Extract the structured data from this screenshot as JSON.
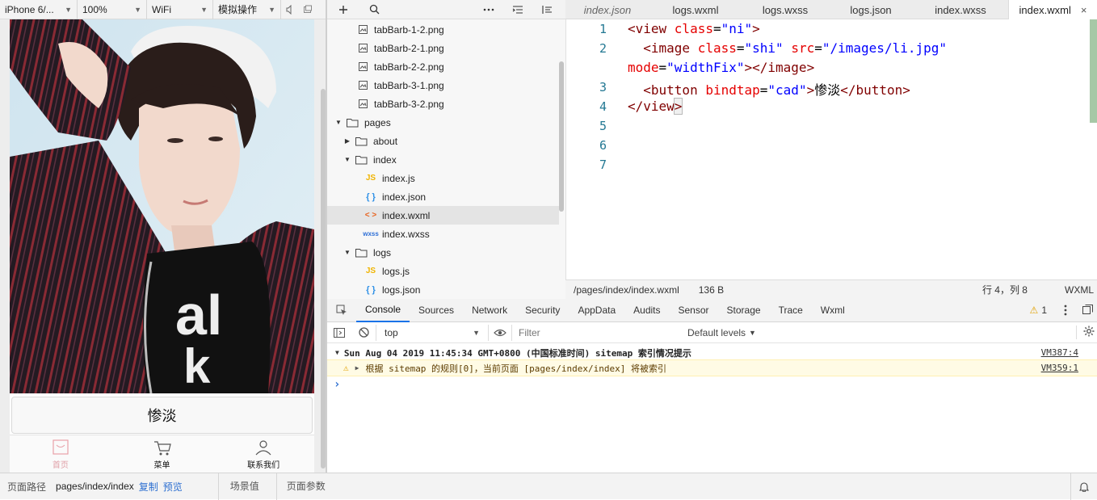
{
  "simulator": {
    "device": "iPhone 6/...",
    "zoom": "100%",
    "network": "WiFi",
    "operation": "模拟操作",
    "button_label": "惨淡",
    "tabs": [
      {
        "label": "首页",
        "active": true
      },
      {
        "label": "菜单",
        "active": false
      },
      {
        "label": "联系我们",
        "active": false
      }
    ]
  },
  "explorer": {
    "items": [
      {
        "label": "tabBarb-1-2.png",
        "type": "image"
      },
      {
        "label": "tabBarb-2-1.png",
        "type": "image"
      },
      {
        "label": "tabBarb-2-2.png",
        "type": "image"
      },
      {
        "label": "tabBarb-3-1.png",
        "type": "image"
      },
      {
        "label": "tabBarb-3-2.png",
        "type": "image"
      },
      {
        "label": "pages",
        "type": "folder-open"
      },
      {
        "label": "about",
        "type": "folder-closed"
      },
      {
        "label": "index",
        "type": "folder-open"
      },
      {
        "label": "index.js",
        "type": "js"
      },
      {
        "label": "index.json",
        "type": "json"
      },
      {
        "label": "index.wxml",
        "type": "wxml",
        "selected": true
      },
      {
        "label": "index.wxss",
        "type": "wxss"
      },
      {
        "label": "logs",
        "type": "folder-open"
      },
      {
        "label": "logs.js",
        "type": "js"
      },
      {
        "label": "logs.json",
        "type": "json"
      }
    ]
  },
  "editor": {
    "tabs": [
      {
        "label": "index.json",
        "italic": true
      },
      {
        "label": "logs.wxml"
      },
      {
        "label": "logs.wxss"
      },
      {
        "label": "logs.json"
      },
      {
        "label": "index.wxss"
      },
      {
        "label": "index.wxml",
        "active": true
      }
    ],
    "close_glyph": "×",
    "line_numbers": [
      "1",
      "2",
      "3",
      "4",
      "5",
      "6",
      "7"
    ],
    "code": {
      "l1_open": "<view ",
      "l1_attr": "class",
      "l1_eq": "=",
      "l1_val": "\"ni\"",
      "l1_close": ">",
      "l2_open": "  <image ",
      "l2_attr1": "class",
      "l2_val1": "\"shi\"",
      "l2_attr2": "src",
      "l2_val2": "\"/images/li.jpg\"",
      "l2b_attr": "mode",
      "l2b_val": "\"widthFix\"",
      "l2b_close": "></image>",
      "l3_open": "  <button ",
      "l3_attr": "bindtap",
      "l3_val": "\"cad\"",
      "l3_gt": ">",
      "l3_text": "惨淡",
      "l3_close": "</button>",
      "l4_open": "</view",
      "l4_close": ">"
    },
    "status": {
      "path": "/pages/index/index.wxml",
      "size": "136 B",
      "cursor": "行 4，列 8",
      "lang": "WXML"
    }
  },
  "devtools": {
    "tabs": [
      "Console",
      "Sources",
      "Network",
      "Security",
      "AppData",
      "Audits",
      "Sensor",
      "Storage",
      "Trace",
      "Wxml"
    ],
    "active_tab": "Console",
    "warning_count": "1",
    "context": "top",
    "filter_placeholder": "Filter",
    "levels": "Default levels",
    "console": {
      "group_header": "Sun Aug 04 2019 11:45:34 GMT+0800 (中国标准时间) sitemap 索引情况提示",
      "group_source": "VM387:4",
      "warning_text": "根据 sitemap 的规则[0]，当前页面 [pages/index/index] 将被索引",
      "warning_source": "VM359:1",
      "prompt": "›"
    }
  },
  "bottom_bar": {
    "path_label": "页面路径",
    "path": "pages/index/index",
    "copy": "复制",
    "preview": "预览",
    "scene": "场景值",
    "params": "页面参数"
  }
}
